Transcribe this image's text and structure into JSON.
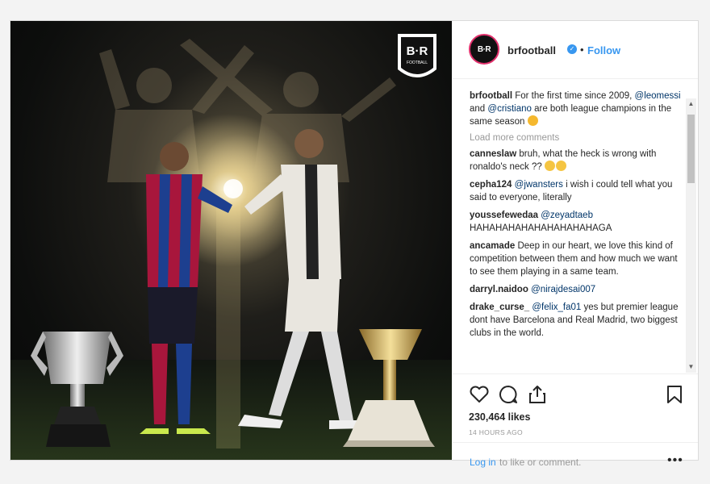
{
  "post": {
    "image_description": "",
    "brand_logo_text": "B·R",
    "brand_logo_sub": "FOOTBALL"
  },
  "header": {
    "avatar_text": "B·R",
    "username": "brfootball",
    "verified_mark": "✓",
    "separator": "•",
    "follow_label": "Follow"
  },
  "caption": {
    "username": "brfootball",
    "text_before": "For the first time since 2009,",
    "mention_1": "@leomessi",
    "text_mid": "and",
    "mention_2": "@cristiano",
    "text_after": "are both league champions in the same season"
  },
  "load_more_label": "Load more comments",
  "comments": [
    {
      "user": "canneslaw",
      "text": "bruh, what the heck is wrong with ronaldo's neck ??"
    },
    {
      "user": "cepha124",
      "mention": "@jwansters",
      "text": "i wish i could tell what you said to everyone, literally"
    },
    {
      "user": "youssefewedaa",
      "mention": "@zeyadtaeb",
      "text": "HAHAHAHAHAHAHAHAHAHAGA"
    },
    {
      "user": "ancamade",
      "text": "Deep in our heart, we love this kind of competition between them and how much we want to see them playing in a same team."
    },
    {
      "user": "darryl.naidoo",
      "mention": "@nirajdesai007",
      "text": ""
    },
    {
      "user": "drake_curse_",
      "mention": "@felix_fa01",
      "text": "yes but premier league dont have Barcelona and Real Madrid, two biggest clubs in the world."
    }
  ],
  "likes": "230,464 likes",
  "timestamp": "14 HOURS AGO",
  "login": {
    "link": "Log in",
    "text": "to like or comment."
  },
  "more_label": "•••",
  "icons": [
    "heart-icon",
    "comment-icon",
    "share-icon",
    "bookmark-icon"
  ],
  "colors": {
    "link_blue": "#3897f0",
    "mention": "#003569",
    "text": "#262626",
    "muted": "#999999"
  }
}
